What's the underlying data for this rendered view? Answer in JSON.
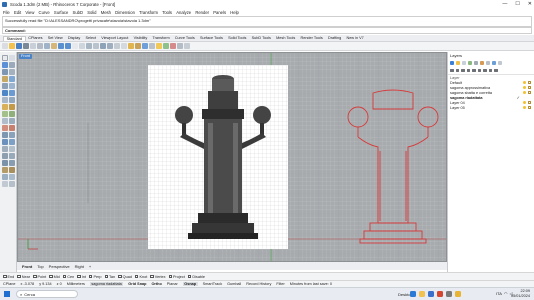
{
  "window": {
    "title": "Scoda 1.3dm (2 MB) - Rhinoceros 7 Corporate - [Front]",
    "controls": [
      "—",
      "☐",
      "✕"
    ]
  },
  "menu": [
    "File",
    "Edit",
    "View",
    "Curve",
    "Surface",
    "SubD",
    "Solid",
    "Mesh",
    "Dimension",
    "Transform",
    "Tools",
    "Analyze",
    "Render",
    "Panels",
    "Help"
  ],
  "command": {
    "history": "Successfully read file \"D:\\ALESSANDRO\\progetti privacafe\\stavoia\\stavoia 1.3dm\"",
    "prompt": "Command:"
  },
  "tabs": [
    "Standard",
    "CPlanes",
    "Set View",
    "Display",
    "Select",
    "Viewport Layout",
    "Visibility",
    "Transform",
    "Curve Tools",
    "Surface Tools",
    "Solid Tools",
    "SubD Tools",
    "Mesh Tools",
    "Render Tools",
    "Drafting",
    "New in V7"
  ],
  "active_tab": "Standard",
  "viewport": {
    "label": "Front",
    "tabs": [
      "Front",
      "Top",
      "Perspective",
      "Right"
    ],
    "add_tab": "+"
  },
  "panel": {
    "title": "Layers",
    "section": "Layer",
    "layers": [
      {
        "name": "Default",
        "current": false
      },
      {
        "name": "sagoma approssimativa",
        "current": false
      },
      {
        "name": "sagoma sbatta e corretta",
        "current": false
      },
      {
        "name": "sagoma riadattata",
        "current": true
      },
      {
        "name": "Layer 04",
        "current": false
      },
      {
        "name": "Layer 05",
        "current": false
      }
    ],
    "checkmark": "✓"
  },
  "osnaps": [
    {
      "label": "End",
      "on": false
    },
    {
      "label": "Near",
      "on": false
    },
    {
      "label": "Point",
      "on": false
    },
    {
      "label": "Mid",
      "on": false
    },
    {
      "label": "Cen",
      "on": false
    },
    {
      "label": "Int",
      "on": false
    },
    {
      "label": "Perp",
      "on": false
    },
    {
      "label": "Tan",
      "on": false
    },
    {
      "label": "Quad",
      "on": false
    },
    {
      "label": "Knot",
      "on": false
    },
    {
      "label": "Vertex",
      "on": false
    },
    {
      "label": "Project",
      "on": false
    },
    {
      "label": "Disable",
      "on": false
    }
  ],
  "status": {
    "cplane": "CPlane",
    "x": "x -3.078",
    "y": "y 9.134",
    "z": "z 0",
    "units": "Millimeters",
    "layer": "sagoma riadattata",
    "toggles": [
      "Grid Snap",
      "Ortho",
      "Planar",
      "Osnap",
      "SmartTrack",
      "Gumball",
      "Record History",
      "Filter"
    ],
    "message": "Minutes from last save: 0"
  },
  "taskbar": {
    "search": "Cerca",
    "desktop": "Desktop",
    "time": "22:09",
    "date": "05/01/2024",
    "lang": "ITA"
  }
}
